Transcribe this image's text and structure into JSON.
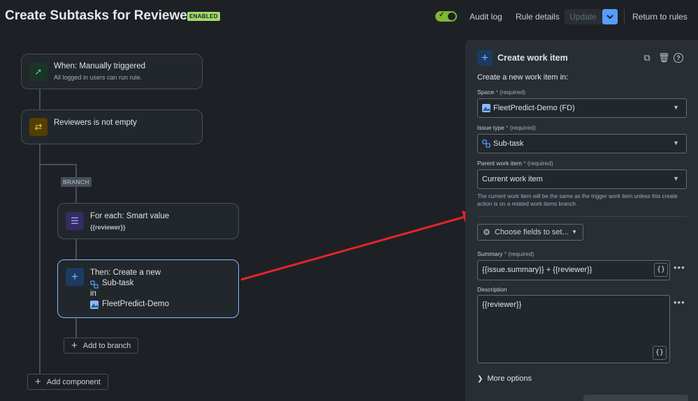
{
  "header": {
    "title": "Create Subtasks for Reviewers",
    "status_badge": "ENABLED",
    "audit_log": "Audit log",
    "rule_details": "Rule details",
    "update": "Update",
    "return_to_rules": "Return to rules"
  },
  "flow": {
    "trigger": {
      "title": "When: Manually triggered",
      "subtitle": "All logged in users can run rule."
    },
    "condition": {
      "title": "Reviewers is not empty"
    },
    "branch_tag": "BRANCH",
    "foreach": {
      "title": "For each: Smart value",
      "subtitle": "{{reviewer}}"
    },
    "action": {
      "line1": "Then: Create a new",
      "issue_type": "Sub-task",
      "line3": "in",
      "project": "FleetPredict-Demo"
    },
    "add_to_branch": "Add to branch",
    "add_component": "Add component"
  },
  "panel": {
    "title": "Create work item",
    "intro": "Create a new work item in:",
    "required_text": "(required)",
    "space_label": "Space",
    "space_value": "FleetPredict-Demo (FD)",
    "issue_type_label": "Issue type",
    "issue_type_value": "Sub-task",
    "parent_label": "Parent work item",
    "parent_value": "Current work item",
    "parent_helper": "The current work item will be the same as the trigger work item unless this create action is on a related work items branch.",
    "choose_fields": "Choose fields to set...",
    "summary_label": "Summary",
    "summary_value": "{{issue.summary}} + {{reviewer}}",
    "description_label": "Description",
    "description_value": "{{reviewer}}",
    "braces": "{}",
    "more_options": "More options"
  },
  "colors": {
    "accent": "#579dff",
    "enabled": "#a6d96a",
    "arrow": "#e5242b"
  }
}
